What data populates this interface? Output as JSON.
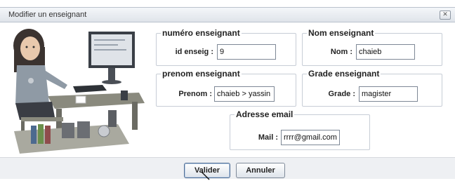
{
  "window": {
    "title": "Modifier un enseignant",
    "close_icon": "close-icon"
  },
  "groups": {
    "numero": {
      "legend": "numéro enseignant",
      "label": "id enseig :",
      "value": "9"
    },
    "nom": {
      "legend": "Nom enseignant",
      "label": "Nom :",
      "value": "chaieb"
    },
    "prenom": {
      "legend": "prenom enseignant",
      "label": "Prenom :",
      "value": "chaieb > yassin"
    },
    "grade": {
      "legend": "Grade enseignant",
      "label": "Grade :",
      "value": "magister"
    },
    "email": {
      "legend": "Adresse email",
      "label": "Mail :",
      "value": "rrrr@gmail.com"
    }
  },
  "buttons": {
    "valider": "Valider",
    "annuler": "Annuler"
  },
  "icons": {
    "illustration": "teacher-desk-illustration",
    "cursor": "mouse-cursor-icon"
  }
}
